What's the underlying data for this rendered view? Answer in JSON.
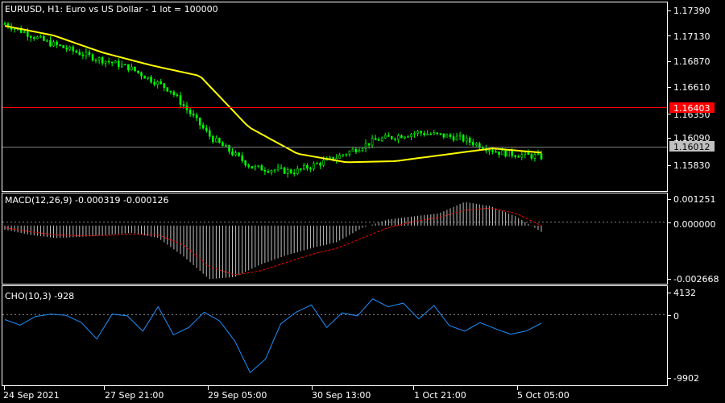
{
  "colors": {
    "background": "#000000",
    "frame": "#ffffff",
    "candle": "#00ff00",
    "ma": "#ffff00",
    "level_line": "#ff0000",
    "level_tag": "#ff0000",
    "bid_line": "#808080",
    "bid_tag": "#c0c0c0",
    "macd_hist": "#c0c0c0",
    "macd_signal": "#ff0000",
    "cho_line": "#1e90ff",
    "zero_line": "#808080"
  },
  "main": {
    "title": "EURUSD, H1:  Euro vs US Dollar - 1 lot = 100000",
    "price_ticks": [
      "1.17390",
      "1.17130",
      "1.16870",
      "1.16610",
      "1.16350",
      "1.16090",
      "1.15830"
    ],
    "level_tag": "1.16403",
    "bid_tag": "1.16012"
  },
  "macd": {
    "title": "MACD(12,26,9) -0.000319 -0.000126",
    "ticks": [
      "0.001251",
      "0.000000",
      "-0.002668"
    ]
  },
  "cho": {
    "title": "CHO(10,3) -928",
    "ticks": [
      "4132",
      "0",
      "-9902"
    ]
  },
  "time_axis": [
    "24 Sep 2021",
    "27 Sep 21:00",
    "29 Sep 05:00",
    "30 Sep 13:00",
    "1 Oct 21:00",
    "5 Oct 05:00"
  ],
  "chart_data": [
    {
      "type": "line",
      "title": "EURUSD, H1:  Euro vs US Dollar - 1 lot = 100000",
      "x": [
        "24 Sep 2021",
        "27 Sep 21:00",
        "29 Sep 05:00",
        "30 Sep 13:00",
        "1 Oct 21:00",
        "5 Oct 05:00"
      ],
      "ylim": [
        1.157,
        1.1747
      ],
      "series": [
        {
          "values": [
            1.1727,
            1.171,
            1.1697,
            1.1686,
            1.1665,
            1.162,
            1.1592,
            1.1588,
            1.1601,
            1.1618,
            1.1625,
            1.162,
            1.1606,
            1.1602
          ]
        },
        {
          "values": [
            1.1725,
            1.1716,
            1.17,
            1.1688,
            1.1678,
            1.163,
            1.1605,
            1.1597,
            1.1598,
            1.1604,
            1.161,
            1.1606
          ]
        }
      ],
      "levels": [
        1.16403,
        1.16012
      ]
    },
    {
      "type": "bar",
      "title": "MACD(12,26,9) -0.000319 -0.000126",
      "ylim": [
        -0.002668,
        0.001251
      ],
      "values": [
        -0.0002,
        -0.00045,
        -0.0006,
        -0.00055,
        -0.00045,
        -0.00035,
        -0.0006,
        -0.0015,
        -0.0026,
        -0.0025,
        -0.0019,
        -0.00145,
        -0.0011,
        -0.0008,
        -0.0001,
        0.0003,
        0.00045,
        0.0006,
        0.00115,
        0.00095,
        0.00045,
        -0.0003
      ],
      "signal": [
        -0.0001,
        -0.0003,
        -0.00045,
        -0.0005,
        -0.00048,
        -0.0004,
        -0.00045,
        -0.00095,
        -0.002,
        -0.0024,
        -0.0022,
        -0.0018,
        -0.0014,
        -0.0011,
        -0.0006,
        -0.0001,
        0.0002,
        0.0004,
        0.00075,
        0.00085,
        0.0006,
        0.0
      ]
    },
    {
      "type": "line",
      "title": "CHO(10,3) -928",
      "ylim": [
        -9902,
        4132
      ],
      "values": [
        -300,
        -1200,
        200,
        600,
        400,
        -800,
        -3500,
        600,
        300,
        -2200,
        1800,
        -2800,
        -1600,
        900,
        -500,
        -3800,
        -9000,
        -6800,
        -1000,
        900,
        2100,
        -1600,
        800,
        300,
        3100,
        1800,
        2400,
        -200,
        2000,
        -1300,
        -2200,
        -800,
        -1800,
        -2700,
        -2200,
        -900
      ]
    }
  ]
}
